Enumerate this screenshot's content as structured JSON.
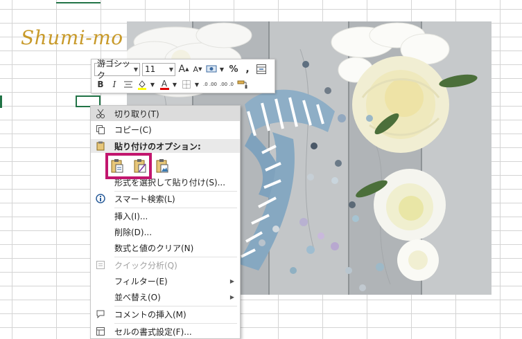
{
  "logo_text": "Shumi-mo",
  "mini_toolbar": {
    "font_name": "游ゴシック",
    "font_size": "11",
    "grow_font": "A",
    "shrink_font": "A",
    "percent": "%",
    "comma": ",",
    "bold": "B",
    "italic": "I",
    "font_color_glyph": "A",
    "decimal_increase": ".0 .00",
    "decimal_decrease": ".00 .0"
  },
  "context_menu": {
    "cut": "切り取り(T)",
    "copy": "コピー(C)",
    "paste_options_header": "貼り付けのオプション:",
    "paste_special": "形式を選択して貼り付け(S)...",
    "smart_lookup": "スマート検索(L)",
    "insert": "挿入(I)...",
    "delete": "削除(D)...",
    "clear_contents": "数式と値のクリア(N)",
    "quick_analysis": "クイック分析(Q)",
    "filter": "フィルター(E)",
    "sort": "並べ替え(O)",
    "insert_comment": "コメントの挿入(M)",
    "format_cells": "セルの書式設定(F)..."
  },
  "colors": {
    "highlight_accent": "#c2166e",
    "excel_green": "#217346",
    "logo_gold": "#c89a2a",
    "font_color_bar": "#e00000",
    "fill_color_bar": "#ffff00"
  }
}
